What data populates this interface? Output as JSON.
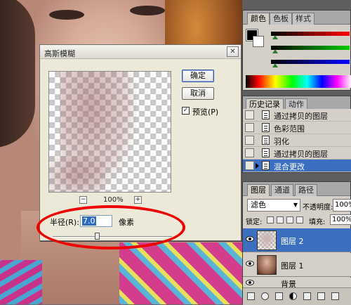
{
  "dialog": {
    "title": "高斯模糊",
    "close_glyph": "✕",
    "ok_label": "确定",
    "cancel_label": "取消",
    "preview_checkbox_label": "预览(P)",
    "preview_checked": true,
    "zoom_minus": "−",
    "zoom_plus": "+",
    "zoom_value": "100%",
    "radius_label": "半径(R):",
    "radius_value": "7.0",
    "radius_unit": "像素",
    "radius_slider_fraction": 0.37
  },
  "color_panel": {
    "tabs": [
      "颜色",
      "色板",
      "样式"
    ],
    "active_tab": 0,
    "foreground": "#000000",
    "background": "#ffffff"
  },
  "history_panel": {
    "tabs": [
      "历史记录",
      "动作"
    ],
    "active_tab": 0,
    "items": [
      {
        "label": "通过拷贝的图层",
        "selected": false
      },
      {
        "label": "色彩范围",
        "selected": false
      },
      {
        "label": "羽化",
        "selected": false
      },
      {
        "label": "通过拷贝的图层",
        "selected": false
      },
      {
        "label": "混合更改",
        "selected": true
      }
    ]
  },
  "layers_panel": {
    "tabs": [
      "图层",
      "通道",
      "路径"
    ],
    "active_tab": 0,
    "blend_mode": "滤色",
    "opacity_label": "不透明度:",
    "opacity_value": "100%",
    "lock_label": "锁定:",
    "fill_label": "填充:",
    "fill_value": "100%",
    "layers": [
      {
        "name": "图层 2",
        "selected": true
      },
      {
        "name": "图层 1",
        "selected": false
      },
      {
        "name": "背景",
        "selected": false
      }
    ]
  },
  "colors": {
    "selection_blue": "#3d6fc0",
    "annotation_red": "#e00000"
  }
}
